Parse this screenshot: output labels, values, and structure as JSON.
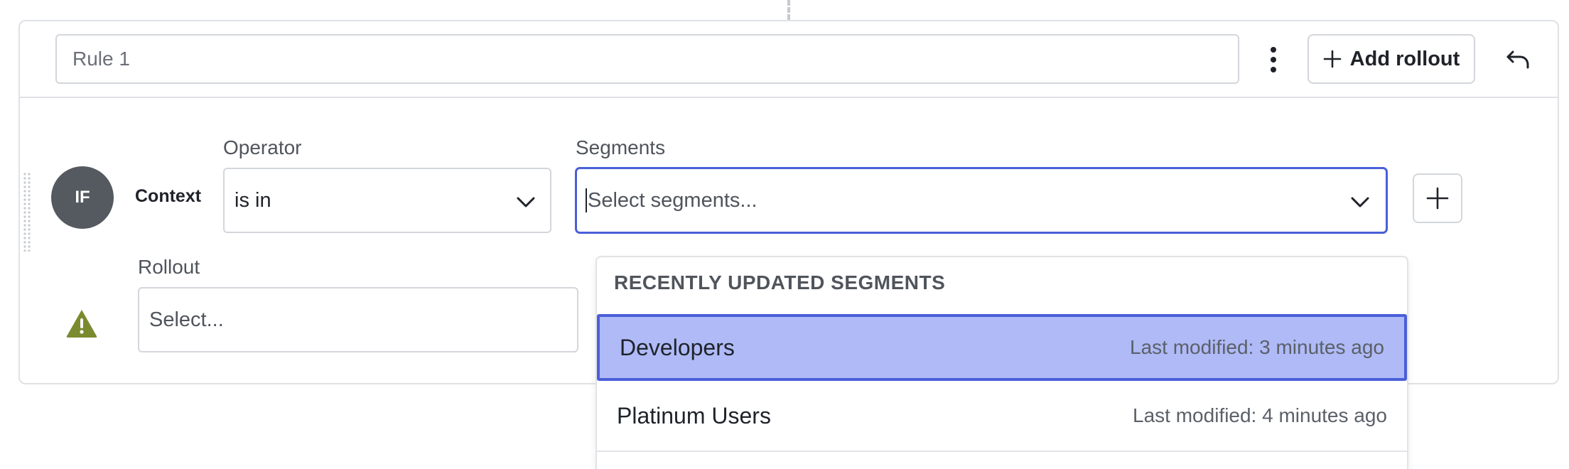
{
  "rule": {
    "name_placeholder": "Rule 1",
    "add_rollout_label": "Add rollout"
  },
  "clause": {
    "badge": "IF",
    "attribute": "Context",
    "operator_label": "Operator",
    "operator_value": "is in",
    "segments_label": "Segments",
    "segments_placeholder": "Select segments..."
  },
  "rollout": {
    "label": "Rollout",
    "placeholder": "Select..."
  },
  "dropdown": {
    "group_header": "RECENTLY UPDATED SEGMENTS",
    "options": [
      {
        "name": "Developers",
        "meta": "Last modified: 3 minutes ago",
        "highlighted": true
      },
      {
        "name": "Platinum Users",
        "meta": "Last modified: 4 minutes ago",
        "highlighted": false
      }
    ]
  },
  "colors": {
    "focus_blue": "#4a5fd9",
    "highlight_bg": "#afbaf7",
    "badge_bg": "#555a61",
    "warning": "#7a8a2e"
  },
  "icons": {
    "kebab": "kebab-menu-icon",
    "plus": "plus-icon",
    "undo": "undo-icon",
    "chevron": "chevron-down-icon",
    "warning": "warning-icon"
  }
}
